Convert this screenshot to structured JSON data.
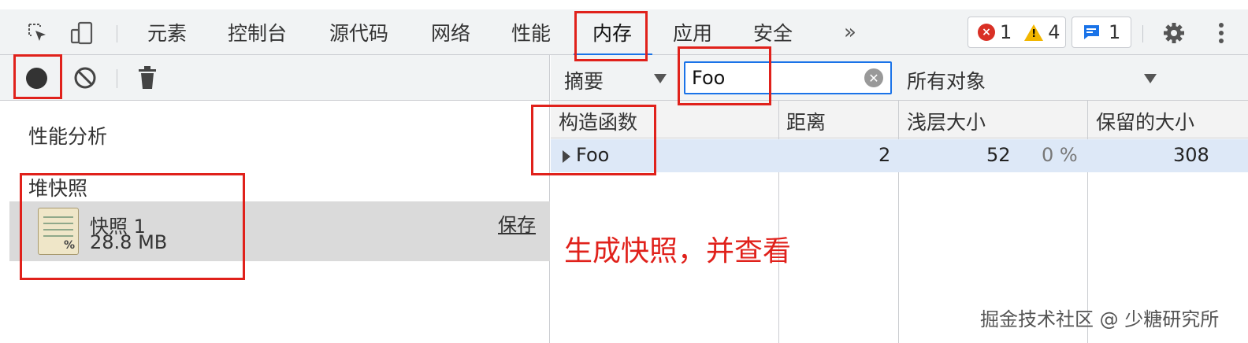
{
  "toolbar": {
    "tabs": [
      "元素",
      "控制台",
      "源代码",
      "网络",
      "性能",
      "内存",
      "应用",
      "安全"
    ],
    "active_tab": "内存",
    "more_label": "»",
    "error_count": "1",
    "warning_count": "4",
    "message_count": "1",
    "icons": [
      "inspect-icon",
      "device-toggle-icon",
      "gear-icon",
      "more-vert-icon"
    ]
  },
  "left_panel": {
    "profiling_heading": "性能分析",
    "heap_snapshots_heading": "堆快照",
    "snapshot": {
      "name": "快照 1",
      "size": "28.8 MB",
      "save_label": "保存"
    },
    "icons": [
      "record-icon",
      "clear-icon",
      "trash-icon"
    ]
  },
  "right_panel": {
    "view_select": "摘要",
    "filter_value": "Foo",
    "object_filter": "所有对象",
    "columns": [
      "构造函数",
      "距离",
      "浅层大小",
      "保留的大小"
    ],
    "rows": [
      {
        "constructor": "Foo",
        "distance": "2",
        "shallow_size": "52",
        "shallow_pct": "0 %",
        "retained_size": "308"
      }
    ]
  },
  "annotation": "生成快照，并查看",
  "watermark": "掘金技术社区 @ 少糖研究所",
  "colors": {
    "accent": "#1a73e8",
    "annotation_red": "#e0211b",
    "selected_row": "#dde8f7"
  }
}
